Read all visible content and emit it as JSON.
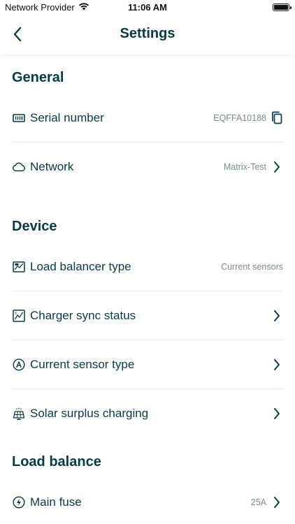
{
  "status_bar": {
    "carrier": "Network Provider",
    "time": "11:06 AM"
  },
  "nav": {
    "title": "Settings"
  },
  "sections": {
    "general": "General",
    "device": "Device",
    "load_balance": "Load balance"
  },
  "general": {
    "serial_label": "Serial number",
    "serial_value": "EQFFA10188",
    "network_label": "Network",
    "network_value": "Matrix-Test"
  },
  "device": {
    "load_balancer_label": "Load balancer type",
    "load_balancer_value": "Current sensors",
    "charger_sync_label": "Charger sync status",
    "current_sensor_label": "Current sensor type",
    "solar_label": "Solar surplus charging"
  },
  "load_balance": {
    "main_fuse_label": "Main fuse",
    "main_fuse_value": "25A"
  },
  "colors": {
    "primary_text": "#0b3a45",
    "secondary_text": "#7a8d92",
    "divider": "#ececec"
  }
}
